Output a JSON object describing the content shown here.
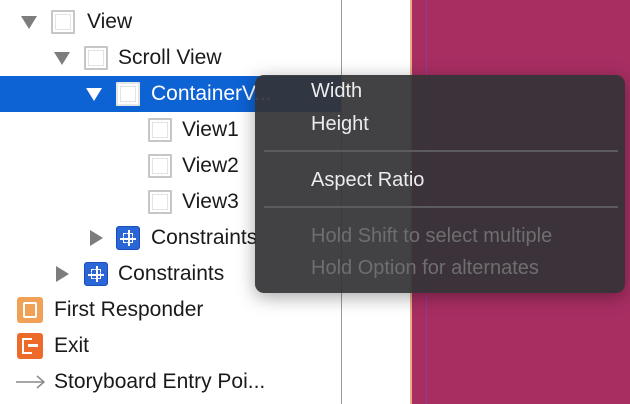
{
  "outline": {
    "items": [
      {
        "label": "View"
      },
      {
        "label": "Scroll View"
      },
      {
        "label": "ContainerV..."
      },
      {
        "label": "View1"
      },
      {
        "label": "View2"
      },
      {
        "label": "View3"
      },
      {
        "label": "Constraints"
      },
      {
        "label": "Constraints"
      },
      {
        "label": "First Responder"
      },
      {
        "label": "Exit"
      },
      {
        "label": "Storyboard Entry Poi..."
      }
    ],
    "selected_index": 2
  },
  "context_menu": {
    "items": [
      {
        "label": "Width",
        "enabled": true
      },
      {
        "label": "Height",
        "enabled": true
      },
      {
        "label": "Aspect Ratio",
        "enabled": true
      },
      {
        "label": "Hold Shift to select multiple",
        "enabled": false
      },
      {
        "label": "Hold Option for alternates",
        "enabled": false
      }
    ]
  },
  "colors": {
    "selection": "#0d62d4",
    "canvas_background": "#a82e62",
    "menu_background": "#343437",
    "constraint_icon": "#2b66d9",
    "first_responder_icon": "#f1a155",
    "exit_icon": "#ee6a2a"
  },
  "icons": {
    "view": "view-box-icon",
    "constraints": "constraints-icon",
    "first_responder": "first-responder-icon",
    "exit": "exit-icon",
    "entry_point": "entry-arrow-icon"
  }
}
